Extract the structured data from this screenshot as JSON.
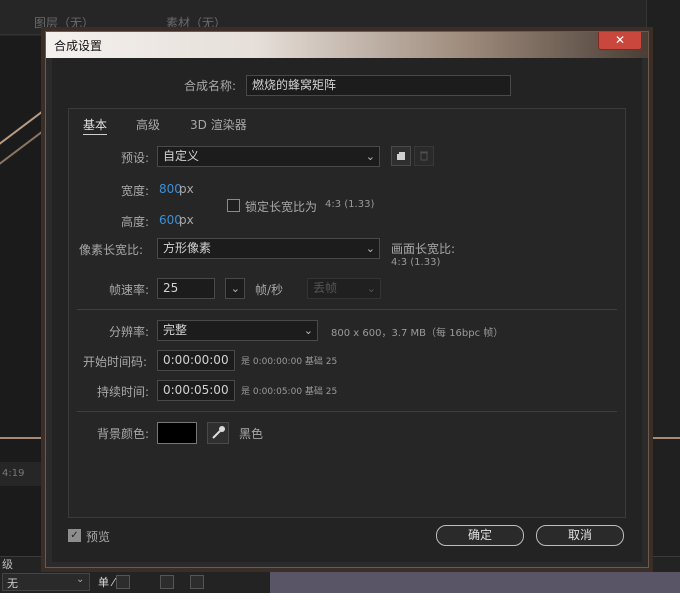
{
  "background": {
    "panel_left": "图层（无）",
    "panel_right": "素材（无）",
    "time_readout": "4:19",
    "bottom_label": "级",
    "bottom_select": "无",
    "tool_symbols": "单  ⁄  fx"
  },
  "dialog": {
    "title": "合成设置",
    "close_symbol": "✕",
    "name_label": "合成名称:",
    "name_value": "燃烧的蜂窝矩阵",
    "tabs": [
      "基本",
      "高级",
      "3D 渲染器"
    ],
    "preset_label": "预设:",
    "preset_value": "自定义",
    "width_label": "宽度:",
    "width_value": "800",
    "width_unit": "px",
    "height_label": "高度:",
    "height_value": "600",
    "height_unit": "px",
    "lock_label": "锁定长宽比为",
    "lock_ratio": "4:3 (1.33)",
    "pixel_aspect_label": "像素长宽比:",
    "pixel_aspect_value": "方形像素",
    "frame_aspect_label": "画面长宽比:",
    "frame_aspect_value": "4:3 (1.33)",
    "fps_label": "帧速率:",
    "fps_value": "25",
    "fps_unit": "帧/秒",
    "drop_frame_value": "丢帧",
    "resolution_label": "分辨率:",
    "resolution_value": "完整",
    "resolution_info": "800 x 600，3.7 MB（每 16bpc 帧）",
    "start_tc_label": "开始时间码:",
    "start_tc_value": "0:00:00:00",
    "start_tc_info": "是 0:00:00:00  基础 25",
    "duration_label": "持续时间:",
    "duration_value": "0:00:05:00",
    "duration_info": "是 0:00:05:00  基础 25",
    "bg_color_label": "背景颜色:",
    "bg_color_name": "黑色",
    "bg_color_hex": "#000000",
    "preview_label": "预览",
    "ok_label": "确定",
    "cancel_label": "取消"
  },
  "colors": {
    "accent_blue": "#3d8fd6",
    "close_red": "#c9473c"
  }
}
